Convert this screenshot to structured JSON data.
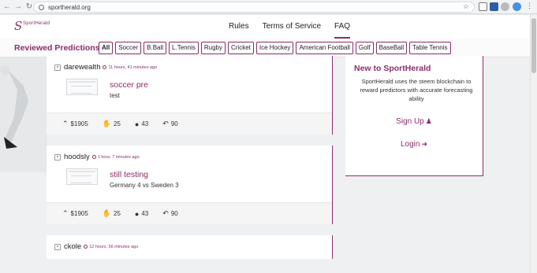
{
  "browser": {
    "url": "sportherald.org"
  },
  "header": {
    "logo_text": "SportHerald",
    "nav": [
      "Rules",
      "Terms of Service",
      "FAQ"
    ],
    "active_nav": "FAQ"
  },
  "filters": {
    "title": "Reviewed Predictions",
    "chips": [
      "All",
      "Soccer",
      "B.Ball",
      "L.Tennis",
      "Rugby",
      "Cricket",
      "Ice Hockey",
      "American Football",
      "Golf",
      "BaseBall",
      "Table Tennis"
    ]
  },
  "posts": [
    {
      "author": "darewealth",
      "time": "11 hours, 41 minutes ago",
      "title": "soccer pre",
      "desc": "test",
      "payout": "$1905",
      "likes": "25",
      "comments": "43",
      "reblogs": "90"
    },
    {
      "author": "hoodsly",
      "time": "1 hour, 7 minutes ago",
      "title": "still testing",
      "desc": "Germany 4 vs Sweden 3",
      "payout": "$1905",
      "likes": "25",
      "comments": "43",
      "reblogs": "90"
    },
    {
      "author": "ckole",
      "time": "12 hours, 56 minutes ago"
    }
  ],
  "sidebar": {
    "title": "New to SportHerald",
    "text": "SportHerald uses the steem blockchain to reward predictors with accurate forecasting ability",
    "signup": "Sign Up",
    "login": "Login"
  },
  "colors": {
    "accent": "#8e2c6b"
  }
}
